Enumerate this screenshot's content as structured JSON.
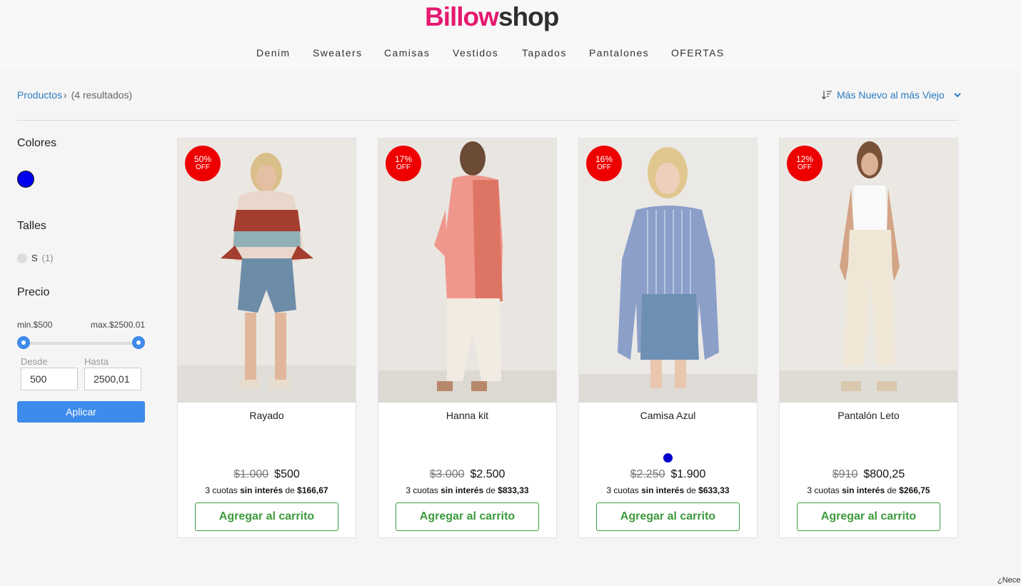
{
  "brand": {
    "part1": "Billow",
    "part2": "shop"
  },
  "nav": [
    "Denim",
    "Sweaters",
    "Camisas",
    "Vestidos",
    "Tapados",
    "Pantalones",
    "OFERTAS"
  ],
  "breadcrumb": {
    "link": "Productos",
    "separator": "›",
    "results": "(4 resultados)"
  },
  "sort": {
    "label": "Más Nuevo al más Viejo",
    "icon": "sort-icon"
  },
  "filters": {
    "colors_title": "Colores",
    "color_value": "#0000ee",
    "sizes_title": "Talles",
    "size_label": "S",
    "size_count": "(1)",
    "price_title": "Precio",
    "min_label": "min.$500",
    "max_label": "max.$2500.01",
    "from_label": "Desde",
    "to_label": "Hasta",
    "from_value": "500",
    "to_value": "2500,01",
    "apply_label": "Aplicar"
  },
  "products": [
    {
      "name": "Rayado",
      "discount": "50%",
      "off": "OFF",
      "old_price": "$1.000",
      "price": "$500",
      "install_pre": "3 cuotas ",
      "install_bold": "sin interés",
      "install_mid": " de ",
      "install_amount": "$166,67",
      "button": "Agregar al carrito"
    },
    {
      "name": "Hanna kit",
      "discount": "17%",
      "off": "OFF",
      "old_price": "$3.000",
      "price": "$2.500",
      "install_pre": "3 cuotas ",
      "install_bold": "sin interés",
      "install_mid": " de ",
      "install_amount": "$833,33",
      "button": "Agregar al carrito"
    },
    {
      "name": "Camisa Azul",
      "discount": "16%",
      "off": "OFF",
      "old_price": "$2.250",
      "price": "$1.900",
      "install_pre": "3 cuotas ",
      "install_bold": "sin interés",
      "install_mid": " de ",
      "install_amount": "$633,33",
      "button": "Agregar al carrito"
    },
    {
      "name": "Pantalón Leto",
      "discount": "12%",
      "off": "OFF",
      "old_price": "$910",
      "price": "$800,25",
      "install_pre": "3 cuotas ",
      "install_bold": "sin interés",
      "install_mid": " de ",
      "install_amount": "$266,75",
      "button": "Agregar al carrito"
    }
  ],
  "colors": {
    "accent": "#3d8bea",
    "brand_pink": "#e5196f",
    "badge": "#ee0000",
    "button_green": "#3d9a3d",
    "link": "#2a7bc0"
  },
  "help_text": "¿Nece"
}
